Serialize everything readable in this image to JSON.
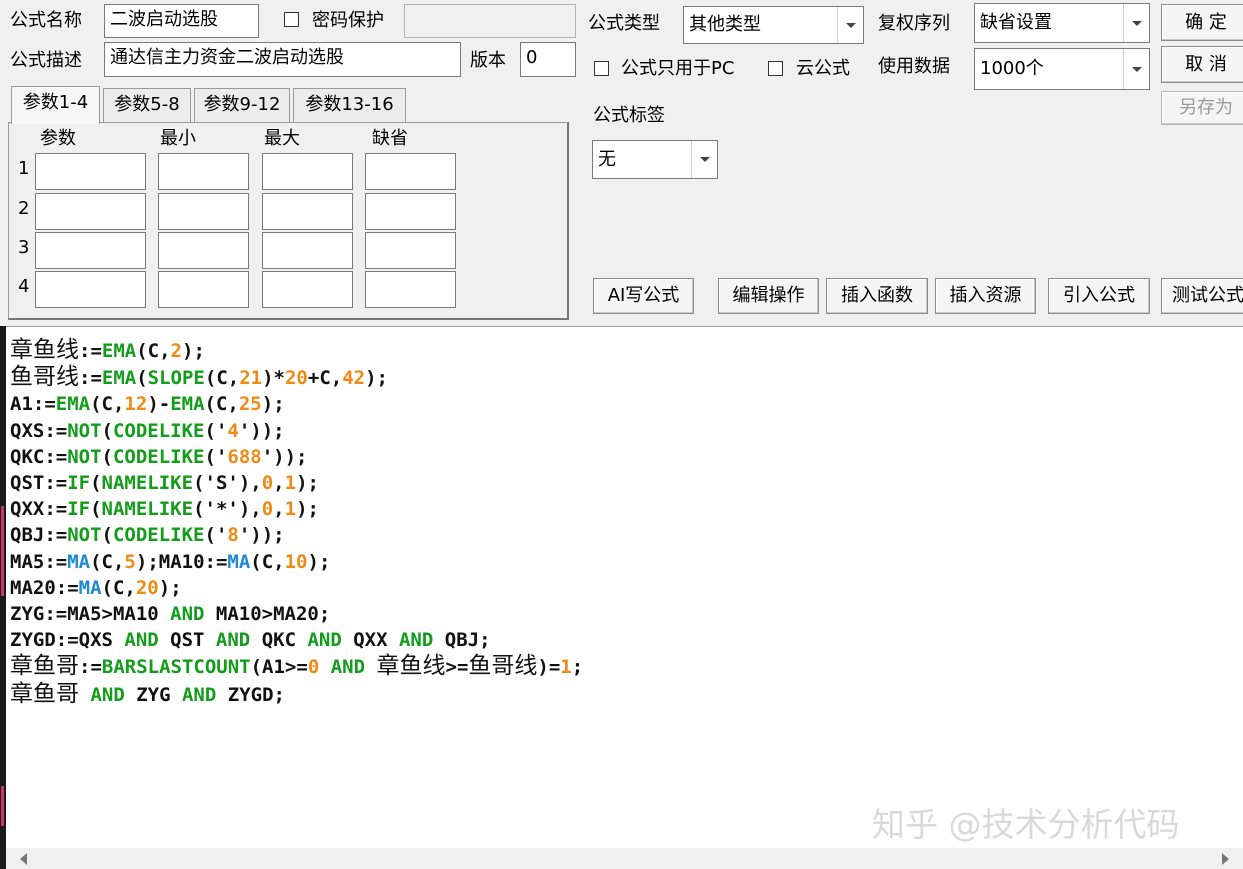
{
  "header": {
    "name_label": "公式名称",
    "name_value": "二波启动选股",
    "password_label": "密码保护",
    "password_value": "",
    "desc_label": "公式描述",
    "desc_value": "通达信主力资金二波启动选股",
    "version_label": "版本",
    "version_value": "0",
    "type_label": "公式类型",
    "type_value": "其他类型",
    "rights_label": "复权序列",
    "rights_value": "缺省设置",
    "pc_only_label": "公式只用于PC",
    "cloud_label": "云公式",
    "data_label": "使用数据",
    "data_value": "1000个",
    "tag_label": "公式标签",
    "tag_value": "无"
  },
  "buttons": {
    "ok": "确 定",
    "cancel": "取 消",
    "save_as": "另存为",
    "ai_write": "AI写公式",
    "edit_ops": "编辑操作",
    "insert_func": "插入函数",
    "insert_res": "插入资源",
    "import_formula": "引入公式",
    "test_formula": "测试公式"
  },
  "tabs": [
    "参数1-4",
    "参数5-8",
    "参数9-12",
    "参数13-16"
  ],
  "params": {
    "headers": [
      "参数",
      "最小",
      "最大",
      "缺省"
    ],
    "rows": [
      "1",
      "2",
      "3",
      "4"
    ]
  },
  "code_lines": [
    [
      [
        "cn",
        "章鱼线"
      ],
      [
        "t",
        ":="
      ],
      [
        "fn",
        "EMA"
      ],
      [
        "t",
        "(C,"
      ],
      [
        "num",
        "2"
      ],
      [
        "t",
        ");"
      ]
    ],
    [
      [
        "cn",
        "鱼哥线"
      ],
      [
        "t",
        ":="
      ],
      [
        "fn",
        "EMA"
      ],
      [
        "t",
        "("
      ],
      [
        "fn",
        "SLOPE"
      ],
      [
        "t",
        "(C,"
      ],
      [
        "num",
        "21"
      ],
      [
        "t",
        ")*"
      ],
      [
        "num",
        "20"
      ],
      [
        "t",
        "+C,"
      ],
      [
        "num",
        "42"
      ],
      [
        "t",
        ");"
      ]
    ],
    [
      [
        "t",
        "A1:="
      ],
      [
        "fn",
        "EMA"
      ],
      [
        "t",
        "(C,"
      ],
      [
        "num",
        "12"
      ],
      [
        "t",
        ")-"
      ],
      [
        "fn",
        "EMA"
      ],
      [
        "t",
        "(C,"
      ],
      [
        "num",
        "25"
      ],
      [
        "t",
        ");"
      ]
    ],
    [
      [
        "t",
        "QXS:="
      ],
      [
        "fn",
        "NOT"
      ],
      [
        "t",
        "("
      ],
      [
        "fn",
        "CODELIKE"
      ],
      [
        "t",
        "('"
      ],
      [
        "num",
        "4"
      ],
      [
        "t",
        "'));"
      ]
    ],
    [
      [
        "t",
        "QKC:="
      ],
      [
        "fn",
        "NOT"
      ],
      [
        "t",
        "("
      ],
      [
        "fn",
        "CODELIKE"
      ],
      [
        "t",
        "('"
      ],
      [
        "num",
        "688"
      ],
      [
        "t",
        "'));"
      ]
    ],
    [
      [
        "t",
        "QST:="
      ],
      [
        "fn",
        "IF"
      ],
      [
        "t",
        "("
      ],
      [
        "fn",
        "NAMELIKE"
      ],
      [
        "t",
        "('S'),"
      ],
      [
        "num",
        "0"
      ],
      [
        "t",
        ","
      ],
      [
        "num",
        "1"
      ],
      [
        "t",
        ");"
      ]
    ],
    [
      [
        "t",
        "QXX:="
      ],
      [
        "fn",
        "IF"
      ],
      [
        "t",
        "("
      ],
      [
        "fn",
        "NAMELIKE"
      ],
      [
        "t",
        "('*'),"
      ],
      [
        "num",
        "0"
      ],
      [
        "t",
        ","
      ],
      [
        "num",
        "1"
      ],
      [
        "t",
        ");"
      ]
    ],
    [
      [
        "t",
        "QBJ:="
      ],
      [
        "fn",
        "NOT"
      ],
      [
        "t",
        "("
      ],
      [
        "fn",
        "CODELIKE"
      ],
      [
        "t",
        "('"
      ],
      [
        "num",
        "8"
      ],
      [
        "t",
        "'));"
      ]
    ],
    [
      [
        "t",
        "MA5:="
      ],
      [
        "ma",
        "MA"
      ],
      [
        "t",
        "(C,"
      ],
      [
        "num",
        "5"
      ],
      [
        "t",
        ");MA10:="
      ],
      [
        "ma",
        "MA"
      ],
      [
        "t",
        "(C,"
      ],
      [
        "num",
        "10"
      ],
      [
        "t",
        ");"
      ]
    ],
    [
      [
        "t",
        "MA20:="
      ],
      [
        "ma",
        "MA"
      ],
      [
        "t",
        "(C,"
      ],
      [
        "num",
        "20"
      ],
      [
        "t",
        ");"
      ]
    ],
    [
      [
        "t",
        "ZYG:=MA5>MA10 "
      ],
      [
        "kw",
        "AND"
      ],
      [
        "t",
        " MA10>MA20;"
      ]
    ],
    [
      [
        "t",
        "ZYGD:=QXS "
      ],
      [
        "kw",
        "AND"
      ],
      [
        "t",
        " QST "
      ],
      [
        "kw",
        "AND"
      ],
      [
        "t",
        " QKC "
      ],
      [
        "kw",
        "AND"
      ],
      [
        "t",
        " QXX "
      ],
      [
        "kw",
        "AND"
      ],
      [
        "t",
        " QBJ;"
      ]
    ],
    [
      [
        "cn",
        "章鱼哥"
      ],
      [
        "t",
        ":="
      ],
      [
        "fn",
        "BARSLASTCOUNT"
      ],
      [
        "t",
        "(A1>="
      ],
      [
        "num",
        "0"
      ],
      [
        "t",
        " "
      ],
      [
        "kw",
        "AND"
      ],
      [
        "t",
        " "
      ],
      [
        "cn",
        "章鱼线"
      ],
      [
        "t",
        ">="
      ],
      [
        "cn",
        "鱼哥线"
      ],
      [
        "t",
        ")="
      ],
      [
        "num",
        "1"
      ],
      [
        "t",
        ";"
      ]
    ],
    [
      [
        "cn",
        "章鱼哥"
      ],
      [
        "t",
        " "
      ],
      [
        "kw",
        "AND"
      ],
      [
        "t",
        " ZYG "
      ],
      [
        "kw",
        "AND"
      ],
      [
        "t",
        " ZYGD;"
      ]
    ]
  ],
  "watermark": "知乎 @技术分析代码"
}
